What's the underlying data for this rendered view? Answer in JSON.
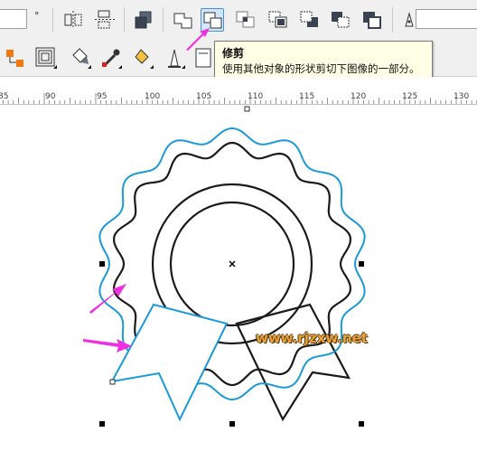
{
  "toolbar": {
    "degree_symbol": "°",
    "shaping_tools": [
      {
        "name": "weld-icon",
        "active": false
      },
      {
        "name": "trim-icon",
        "active": true
      },
      {
        "name": "intersect-icon",
        "active": false
      },
      {
        "name": "simplify-icon",
        "active": false
      },
      {
        "name": "front-minus-back-icon",
        "active": false
      },
      {
        "name": "back-minus-front-icon",
        "active": false
      },
      {
        "name": "boundary-icon",
        "active": false
      }
    ]
  },
  "tooltip": {
    "title": "修剪",
    "description": "使用其他对象的形状剪切下图像的一部分。"
  },
  "ruler": {
    "labels": [
      "85",
      "90",
      "95",
      "100",
      "105",
      "110",
      "115",
      "120",
      "125",
      "130"
    ]
  },
  "watermark": "www.rjzxw.net",
  "colors": {
    "selected_outline": "#1a9ad6",
    "object_outline": "#1c1a1a",
    "arrow": "#ee30e0",
    "toolbar_bg": "#f0f0f0"
  }
}
